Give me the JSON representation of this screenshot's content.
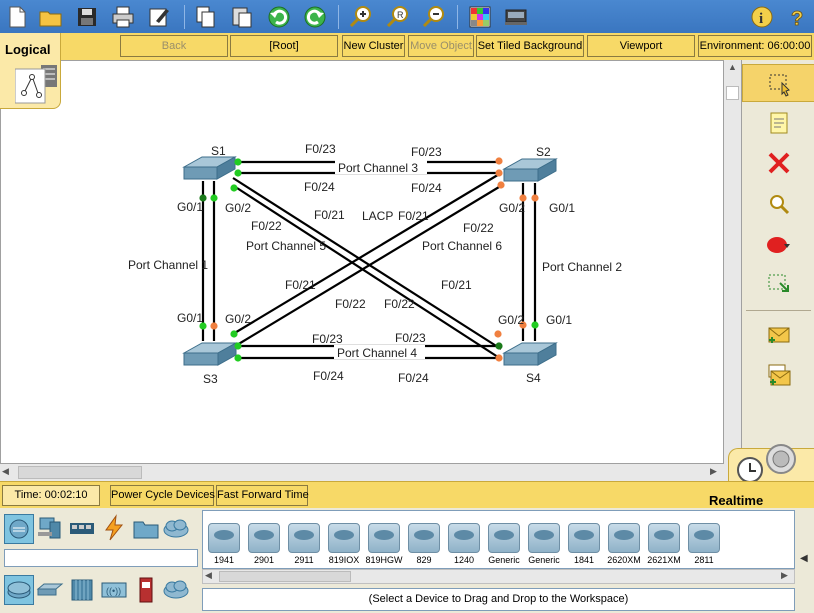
{
  "toolbar": {
    "icons": [
      "new-icon",
      "open-icon",
      "save-icon",
      "print-icon",
      "activity-wizard-icon",
      "copy-icon",
      "paste-icon",
      "undo-icon",
      "redo-icon",
      "zoom-in-icon",
      "zoom-reset-icon",
      "zoom-out-icon",
      "palette-icon",
      "custom-device-icon",
      "info-icon",
      "help-icon"
    ]
  },
  "tabbar": {
    "logical_label": "Logical",
    "buttons": [
      "Back",
      "[Root]",
      "New Cluster",
      "Move Object",
      "Set Tiled Background",
      "Viewport",
      "Environment: 06:00:00"
    ]
  },
  "topology": {
    "switches": [
      "S1",
      "S2",
      "S3",
      "S4"
    ],
    "labels": {
      "s1_s2_top": "F0/23",
      "s2_s1_top": "F0/23",
      "s1_s2_bottom": "F0/24",
      "s2_s1_bottom": "F0/24",
      "pc3": "Port Channel 3",
      "s3_s4_top": "F0/23",
      "s4_s3_top": "F0/23",
      "s3_s4_bottom": "F0/24",
      "s4_s3_bottom": "F0/24",
      "pc4": "Port Channel 4",
      "s1_g01": "G0/1",
      "s1_g02": "G0/2",
      "s3_g01": "G0/1",
      "s3_g02": "G0/2",
      "pc1": "Port Channel 1",
      "s2_g02": "G0/2",
      "s2_g01": "G0/1",
      "s4_g02": "G0/2",
      "s4_g01": "G0/1",
      "pc2": "Port Channel 2",
      "s1_f021": "F0/21",
      "s1_f022": "F0/22",
      "pc5": "Port Channel 5",
      "lacp": "LACP",
      "s2_f021": "F0/21",
      "s2_f022": "F0/22",
      "pc6": "Port Channel 6",
      "s3_f021": "F0/21",
      "s3_f022": "F0/22",
      "s4_f022": "F0/22",
      "s4_f021": "F0/21"
    },
    "colors": {
      "link": "#000000",
      "up": "#22cc22",
      "down": "#f08040",
      "dark_up": "#1a7a1a"
    }
  },
  "right_panel": {
    "icons": [
      "select-icon",
      "note-icon",
      "delete-icon",
      "inspect-icon",
      "draw-shape-icon",
      "resize-icon",
      "add-simple-pdu-icon",
      "add-complex-pdu-icon"
    ]
  },
  "statusbar": {
    "time": "Time: 00:02:10",
    "power_cycle": "Power Cycle Devices",
    "fast_forward": "Fast Forward Time",
    "realtime": "Realtime"
  },
  "device_panel": {
    "devices": [
      "1941",
      "2901",
      "2911",
      "819IOX",
      "819HGW",
      "829",
      "1240",
      "Generic",
      "Generic",
      "1841",
      "2620XM",
      "2621XM",
      "2811"
    ],
    "hint": "(Select a Device to Drag and Drop to the Workspace)"
  }
}
